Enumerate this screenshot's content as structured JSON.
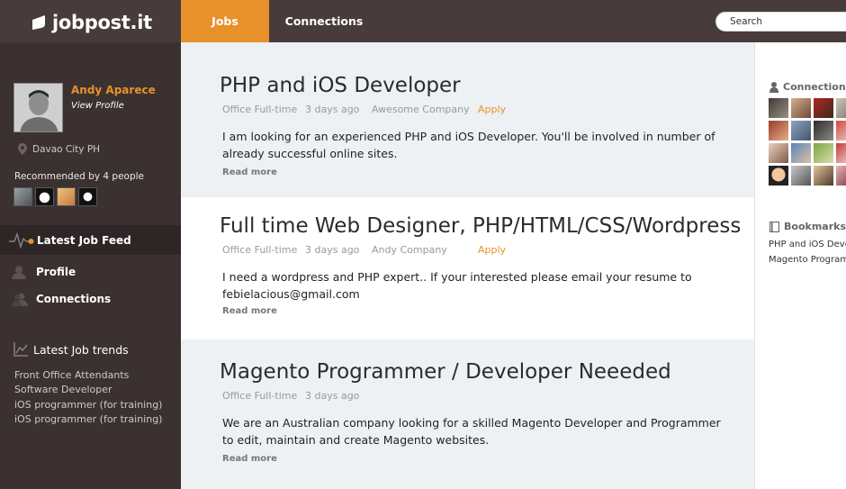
{
  "header": {
    "logo_text": "jobpost.it",
    "tabs": [
      {
        "label": "Jobs",
        "active": true
      },
      {
        "label": "Connections",
        "active": false
      }
    ],
    "search_placeholder": "Search"
  },
  "sidebar": {
    "user_name": "Andy Aparece",
    "view_profile": "View Profile",
    "location": "Davao City PH",
    "recommended": "Recommended by 4 people",
    "nav": [
      {
        "label": "Latest Job Feed",
        "icon": "pulse-icon",
        "active": true
      },
      {
        "label": "Profile",
        "icon": "user-icon",
        "active": false
      },
      {
        "label": "Connections",
        "icon": "users-icon",
        "active": false
      }
    ],
    "trends_title": "Latest Job trends",
    "trends": [
      "Front Office Attendants",
      "Software Developer",
      "iOS programmer (for training)",
      "iOS programmer (for training)"
    ]
  },
  "jobs": [
    {
      "title": "PHP and iOS Developer",
      "type": "Office Full-time",
      "time": "3 days ago",
      "company": "Awesome Company",
      "apply": "Apply",
      "description": "I am looking for an experienced PHP and iOS Developer. You'll be involved in number of already successful online sites.",
      "read_more": "Read more"
    },
    {
      "title": "Full time Web Designer, PHP/HTML/CSS/Wordpress",
      "type": "Office Full-time",
      "time": "3 days ago",
      "company": "Andy Company",
      "apply": "Apply",
      "description": "I need a wordpress and PHP expert.. If your interested please email your resume to febielacious@gmail.com",
      "read_more": "Read more"
    },
    {
      "title": "Magento Programmer / Developer Neeeded",
      "type": "Office Full-time",
      "time": "3 days ago",
      "company": "",
      "apply": "",
      "description": "We are an Australian company looking for a skilled Magento Developer and Programmer to edit, maintain and create Magento websites.",
      "read_more": "Read more"
    }
  ],
  "right_panel": {
    "connections_title": "Connections",
    "bookmarks_title": "Bookmarks",
    "bookmarks": [
      "PHP and iOS Deve",
      "Magento Programm"
    ]
  },
  "colors": {
    "accent": "#e8912b",
    "topbar": "#473b3b",
    "sidebar": "#3b3131"
  }
}
